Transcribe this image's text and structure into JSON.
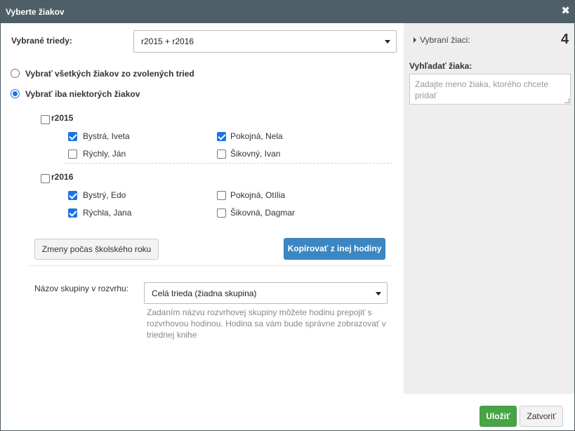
{
  "dialog": {
    "title": "Vyberte žiakov",
    "close_symbol": "✖"
  },
  "classes": {
    "label": "Vybrané triedy:",
    "value": "r2015 + r2016"
  },
  "mode": {
    "all_label": "Vybrať všetkých žiakov zo zvolených tried",
    "all_selected": false,
    "some_label": "Vybrať iba niektorých žiakov",
    "some_selected": true
  },
  "groups": [
    {
      "name": "r2015",
      "checked": false,
      "students": [
        {
          "name": "Bystrá, Iveta",
          "checked": true
        },
        {
          "name": "Pokojná, Nela",
          "checked": true
        },
        {
          "name": "Rýchly, Ján",
          "checked": false
        },
        {
          "name": "Šikovný, Ivan",
          "checked": false
        }
      ]
    },
    {
      "name": "r2016",
      "checked": false,
      "students": [
        {
          "name": "Bystrý, Edo",
          "checked": true
        },
        {
          "name": "Pokojná, Otília",
          "checked": false
        },
        {
          "name": "Rýchla, Jana",
          "checked": true
        },
        {
          "name": "Šikovná, Dagmar",
          "checked": false
        }
      ]
    }
  ],
  "buttons": {
    "changes": "Zmeny počas školského roku",
    "copy": "Kopírovať z inej hodiny",
    "save": "Uložiť",
    "close": "Zatvoriť"
  },
  "schedule_group": {
    "label": "Názov skupiny v rozvrhu:",
    "value": "Celá trieda (žiadna skupina)",
    "help": "Zadaním názvu rozvrhovej skupiny môžete hodinu prepojiť s rozvrhovou hodinou. Hodina sa vám bude správne zobrazovať v triednej knihe"
  },
  "right_panel": {
    "selected_label": "Vybraní žiaci:",
    "selected_count": "4",
    "search_label": "Vyhľadať žiaka:",
    "search_placeholder": "Zadajte meno žiaka, ktorého chcete pridať"
  },
  "colors": {
    "titlebar": "#4e5f68",
    "accent": "#1a73e8",
    "primary_button": "#3c87c3",
    "success_button": "#47a447",
    "side_panel": "#eeeeee"
  }
}
